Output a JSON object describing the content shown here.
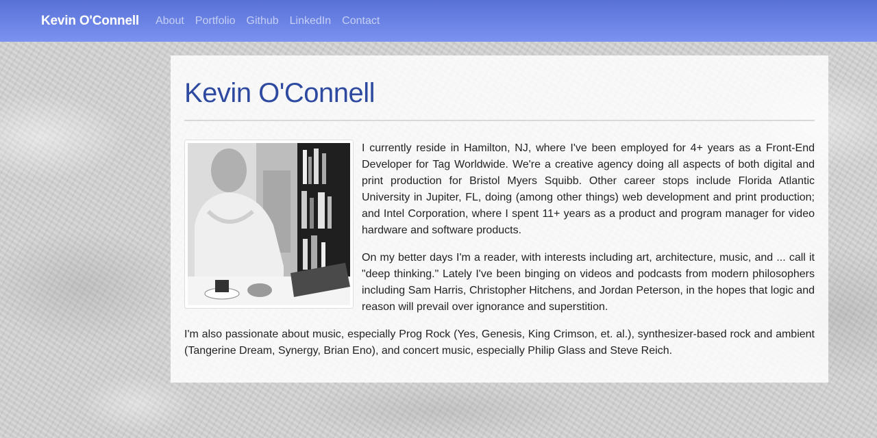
{
  "nav": {
    "brand": "Kevin O'Connell",
    "links": [
      "About",
      "Portfolio",
      "Github",
      "LinkedIn",
      "Contact"
    ]
  },
  "main": {
    "title": "Kevin O'Connell",
    "paragraphs": [
      "I currently reside in Hamilton, NJ, where I've been employed for 4+ years as a Front-End Developer for Tag Worldwide. We're a creative agency doing all aspects of both digital and print production for Bristol Myers Squibb. Other career stops include Florida Atlantic University in Jupiter, FL, doing (among other things) web development and print production; and Intel Corporation, where I spent 11+ years as a product and program manager for video hardware and software products.",
      "On my better days I'm a reader, with interests including art, architecture, music, and ... call it \"deep thinking.\" Lately I've been binging on videos and podcasts from modern philosophers including Sam Harris, Christopher Hitchens, and Jordan Peterson, in the hopes that logic and reason will prevail over ignorance and superstition.",
      "I'm also passionate about music, especially Prog Rock (Yes, Genesis, King Crimson, et. al.), synthesizer-based rock and ambient (Tangerine Dream, Synergy, Brian Eno), and concert music, especially Philip Glass and Steve Reich."
    ]
  },
  "colors": {
    "nav_gradient_top": "#5871d6",
    "nav_gradient_bottom": "#7b92f0",
    "title": "#2d4aa0"
  }
}
